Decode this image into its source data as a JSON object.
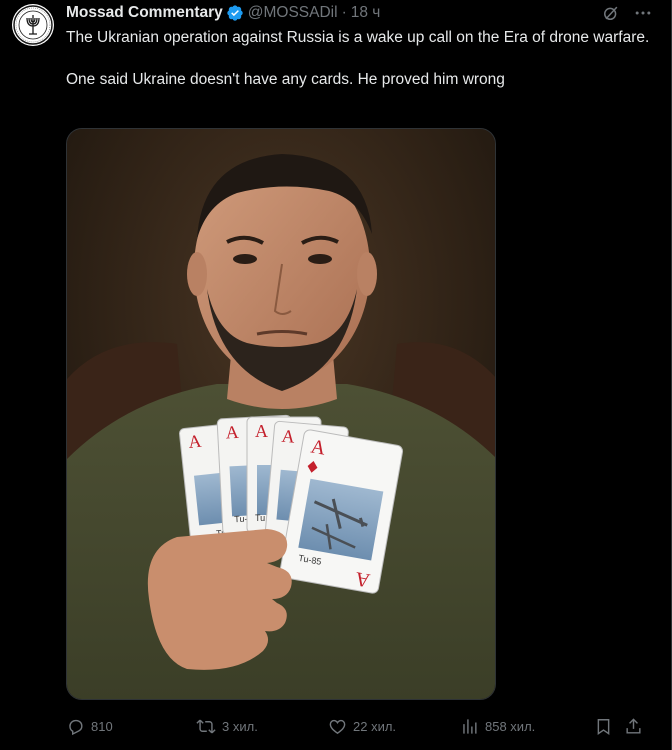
{
  "tweet": {
    "author_name": "Mossad Commentary",
    "handle": "@MOSSADil",
    "separator": "·",
    "time": "18 ч",
    "text_line1": "The Ukranian operation against Russia is a wake up call on the Era of drone warfare.",
    "text_line2": "One said Ukraine doesn't have any cards. He proved him wrong"
  },
  "media": {
    "card_rank": "A",
    "card_captions": [
      "Tu-1",
      "Tu-",
      "Tu",
      "Tu-85"
    ]
  },
  "actions": {
    "replies": "810",
    "reposts": "3 хил.",
    "likes": "22 хил.",
    "views": "858 хил."
  },
  "colors": {
    "background": "#000000",
    "text": "#e7e9ea",
    "muted": "#71767b",
    "verified": "#1d9bf0",
    "card_red": "#c4202c"
  },
  "icons": {
    "avatar": "mossad-emblem-icon",
    "verified": "verified-badge-icon",
    "grok": "grok-icon",
    "more": "more-dots-icon",
    "reply": "reply-icon",
    "repost": "repost-icon",
    "like": "heart-icon",
    "views": "views-chart-icon",
    "bookmark": "bookmark-icon",
    "share": "share-icon"
  }
}
